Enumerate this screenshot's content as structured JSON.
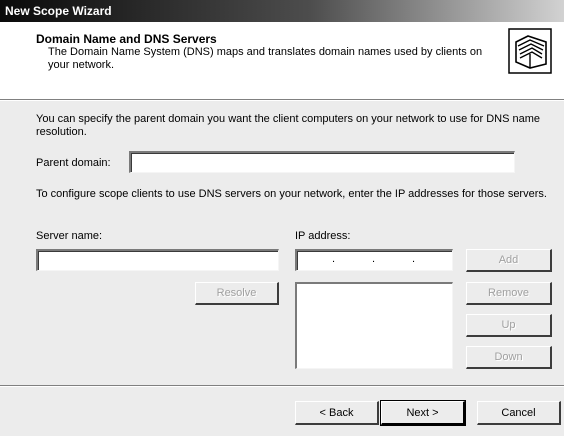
{
  "window": {
    "title": "New Scope Wizard"
  },
  "header": {
    "title": "Domain Name and DNS Servers",
    "description": "The Domain Name System (DNS) maps and translates domain names used by clients on your network.",
    "icon": "folders-icon"
  },
  "content": {
    "intro_text": "You can specify the parent domain you want the client computers on your network to use for DNS name resolution.",
    "parent_domain_label": "Parent domain:",
    "parent_domain_value": "",
    "servers_text": "To configure scope clients to use DNS servers on your network, enter the IP addresses for those servers.",
    "server_name_label": "Server name:",
    "server_name_value": "",
    "ip_address_label": "IP address:",
    "ip_dots": [
      ".",
      ".",
      "."
    ],
    "resolve_label": "Resolve",
    "add_label": "Add",
    "remove_label": "Remove",
    "up_label": "Up",
    "down_label": "Down",
    "ip_list": []
  },
  "footer": {
    "back_label": "< Back",
    "next_label": "Next >",
    "cancel_label": "Cancel"
  }
}
